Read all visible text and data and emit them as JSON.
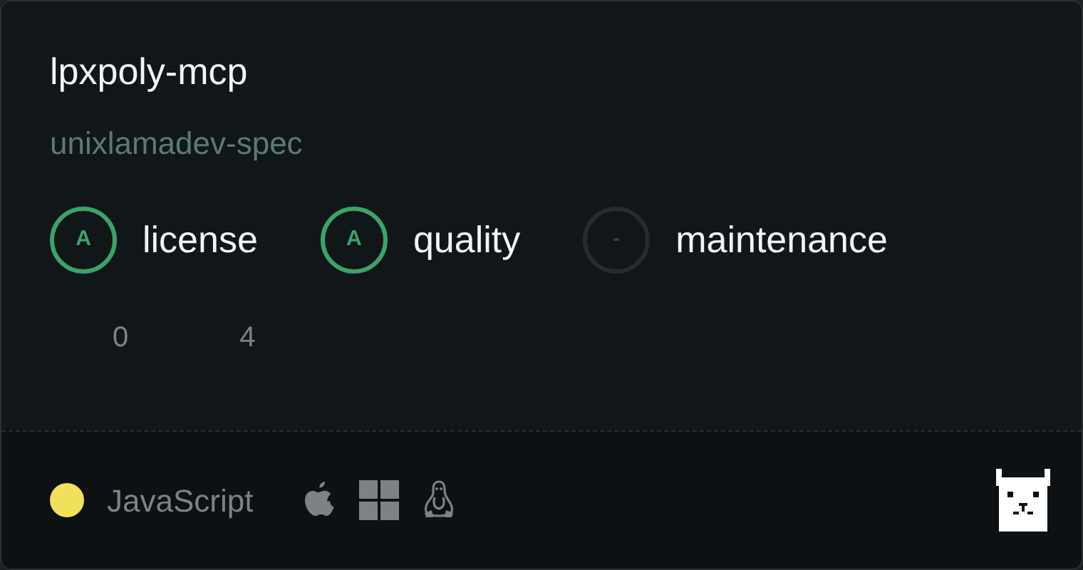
{
  "package": {
    "name": "lpxpoly-mcp",
    "owner": "unixlamadev-spec"
  },
  "scores": [
    {
      "grade": "A",
      "label": "license",
      "color": "#3aa36a"
    },
    {
      "grade": "A",
      "label": "quality",
      "color": "#3aa36a"
    },
    {
      "grade": "-",
      "label": "maintenance",
      "color": "#262b2e"
    }
  ],
  "counts": [
    "0",
    "4"
  ],
  "footer": {
    "languages": [
      {
        "name": "JavaScript",
        "color": "#f1e05a"
      }
    ],
    "platforms": [
      {
        "kind": "apple"
      },
      {
        "kind": "windows"
      },
      {
        "kind": "linux"
      }
    ]
  }
}
